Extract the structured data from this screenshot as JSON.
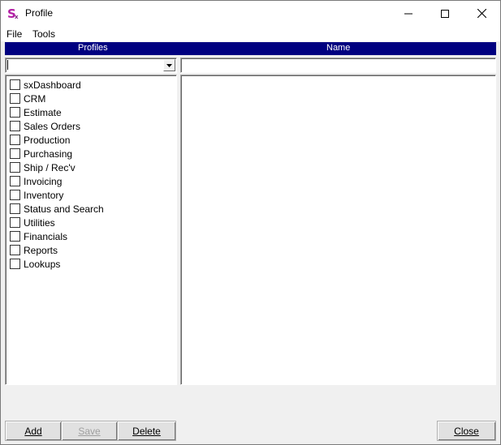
{
  "window": {
    "title": "Profile",
    "icon": "sx-app-icon",
    "brand_color": "#b31fa5"
  },
  "menu": {
    "file": "File",
    "tools": "Tools"
  },
  "header": {
    "profiles": "Profiles",
    "name": "Name",
    "background": "#000080"
  },
  "profile_combo": {
    "value": ""
  },
  "name_field": {
    "value": ""
  },
  "modules": [
    {
      "label": "sxDashboard",
      "checked": false
    },
    {
      "label": "CRM",
      "checked": false
    },
    {
      "label": "Estimate",
      "checked": false
    },
    {
      "label": "Sales Orders",
      "checked": false
    },
    {
      "label": "Production",
      "checked": false
    },
    {
      "label": "Purchasing",
      "checked": false
    },
    {
      "label": "Ship / Rec'v",
      "checked": false
    },
    {
      "label": "Invoicing",
      "checked": false
    },
    {
      "label": "Inventory",
      "checked": false
    },
    {
      "label": "Status and Search",
      "checked": false
    },
    {
      "label": "Utilities",
      "checked": false
    },
    {
      "label": "Financials",
      "checked": false
    },
    {
      "label": "Reports",
      "checked": false
    },
    {
      "label": "Lookups",
      "checked": false
    }
  ],
  "buttons": {
    "add": "Add",
    "save": "Save",
    "delete": "Delete",
    "close": "Close",
    "save_enabled": false
  }
}
